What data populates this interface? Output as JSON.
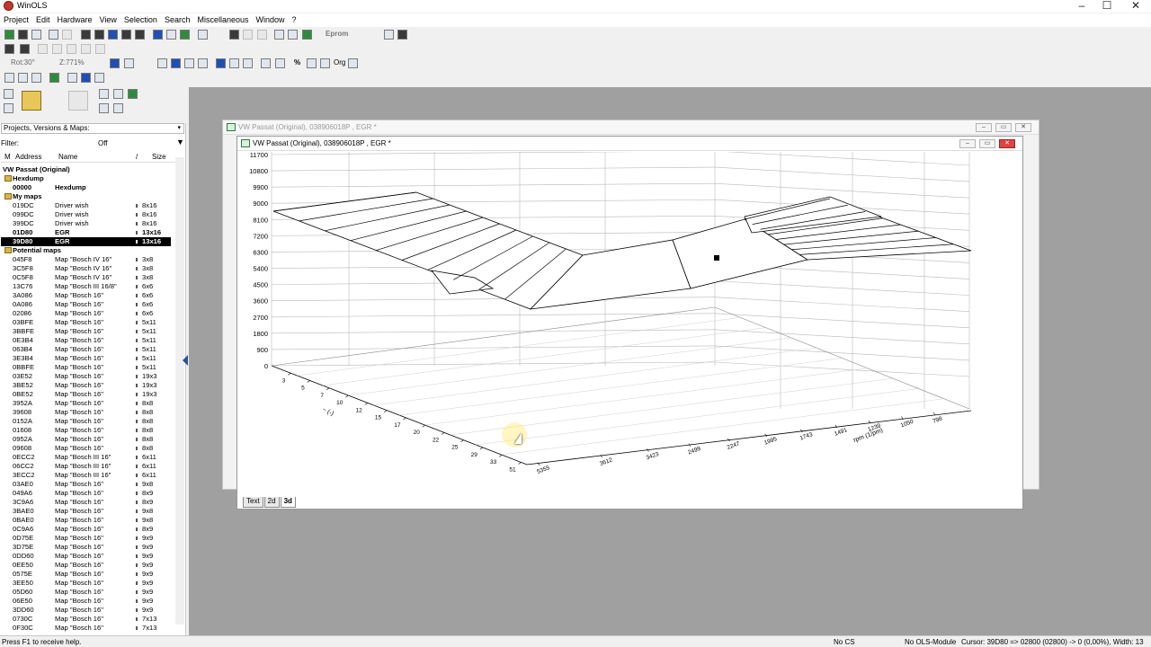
{
  "app": {
    "title": "WinOLS"
  },
  "menu": [
    "Project",
    "Edit",
    "Hardware",
    "View",
    "Selection",
    "Search",
    "Miscellaneous",
    "Window",
    "?"
  ],
  "toolbar": {
    "eprom_label": "Eprom",
    "rot_label": "Rot:30°",
    "zoom_label": "Z:771%",
    "pct_label": "%",
    "org_label": "Org"
  },
  "left_panel": {
    "dropdown_value": "Projects, Versions & Maps:",
    "filter_label": "Filter:",
    "filter_value": "Off",
    "headers": {
      "m": "M",
      "address": "Address",
      "name": "Name",
      "size": "Size"
    },
    "project": "VW Passat (Original)",
    "groups": {
      "hexdump": "Hexdump",
      "my_maps": "My maps",
      "potential": "Potential maps"
    },
    "hexdump_row": {
      "address": "00000",
      "name": "Hexdump"
    },
    "my_maps": [
      {
        "address": "019DC",
        "name": "Driver wish",
        "size": "8x16"
      },
      {
        "address": "099DC",
        "name": "Driver wish",
        "size": "8x16"
      },
      {
        "address": "399DC",
        "name": "Driver wish",
        "size": "8x16"
      },
      {
        "address": "01D80",
        "name": "EGR",
        "size": "13x16"
      },
      {
        "address": "39D80",
        "name": "EGR",
        "size": "13x16"
      }
    ],
    "potential_maps": [
      {
        "address": "045F8",
        "name": "Map \"Bosch IV 16\"",
        "size": "3x8"
      },
      {
        "address": "3C5F8",
        "name": "Map \"Bosch IV 16\"",
        "size": "3x8"
      },
      {
        "address": "0C5F8",
        "name": "Map \"Bosch IV 16\"",
        "size": "3x8"
      },
      {
        "address": "13C76",
        "name": "Map \"Bosch III 16/8\"",
        "size": "6x6"
      },
      {
        "address": "3A086",
        "name": "Map \"Bosch 16\"",
        "size": "6x6"
      },
      {
        "address": "0A086",
        "name": "Map \"Bosch 16\"",
        "size": "6x6"
      },
      {
        "address": "02086",
        "name": "Map \"Bosch 16\"",
        "size": "6x6"
      },
      {
        "address": "03BFE",
        "name": "Map \"Bosch 16\"",
        "size": "5x11"
      },
      {
        "address": "3BBFE",
        "name": "Map \"Bosch 16\"",
        "size": "5x11"
      },
      {
        "address": "0E3B4",
        "name": "Map \"Bosch 16\"",
        "size": "5x11"
      },
      {
        "address": "063B4",
        "name": "Map \"Bosch 16\"",
        "size": "5x11"
      },
      {
        "address": "3E3B4",
        "name": "Map \"Bosch 16\"",
        "size": "5x11"
      },
      {
        "address": "0BBFE",
        "name": "Map \"Bosch 16\"",
        "size": "5x11"
      },
      {
        "address": "03E52",
        "name": "Map \"Bosch 16\"",
        "size": "19x3"
      },
      {
        "address": "3BE52",
        "name": "Map \"Bosch 16\"",
        "size": "19x3"
      },
      {
        "address": "0BE52",
        "name": "Map \"Bosch 16\"",
        "size": "19x3"
      },
      {
        "address": "3952A",
        "name": "Map \"Bosch 16\"",
        "size": "8x8"
      },
      {
        "address": "39608",
        "name": "Map \"Bosch 16\"",
        "size": "8x8"
      },
      {
        "address": "0152A",
        "name": "Map \"Bosch 16\"",
        "size": "8x8"
      },
      {
        "address": "01608",
        "name": "Map \"Bosch 16\"",
        "size": "8x8"
      },
      {
        "address": "0952A",
        "name": "Map \"Bosch 16\"",
        "size": "8x8"
      },
      {
        "address": "09608",
        "name": "Map \"Bosch 16\"",
        "size": "8x8"
      },
      {
        "address": "0ECC2",
        "name": "Map \"Bosch III 16\"",
        "size": "6x11"
      },
      {
        "address": "06CC2",
        "name": "Map \"Bosch III 16\"",
        "size": "6x11"
      },
      {
        "address": "3ECC2",
        "name": "Map \"Bosch III 16\"",
        "size": "6x11"
      },
      {
        "address": "03AE0",
        "name": "Map \"Bosch 16\"",
        "size": "9x8"
      },
      {
        "address": "049A6",
        "name": "Map \"Bosch 16\"",
        "size": "8x9"
      },
      {
        "address": "3C9A6",
        "name": "Map \"Bosch 16\"",
        "size": "8x9"
      },
      {
        "address": "3BAE0",
        "name": "Map \"Bosch 16\"",
        "size": "9x8"
      },
      {
        "address": "0BAE0",
        "name": "Map \"Bosch 16\"",
        "size": "9x8"
      },
      {
        "address": "0C9A6",
        "name": "Map \"Bosch 16\"",
        "size": "8x9"
      },
      {
        "address": "0D75E",
        "name": "Map \"Bosch 16\"",
        "size": "9x9"
      },
      {
        "address": "3D75E",
        "name": "Map \"Bosch 16\"",
        "size": "9x9"
      },
      {
        "address": "0DD60",
        "name": "Map \"Bosch 16\"",
        "size": "9x9"
      },
      {
        "address": "0EE50",
        "name": "Map \"Bosch 16\"",
        "size": "9x9"
      },
      {
        "address": "0575E",
        "name": "Map \"Bosch 16\"",
        "size": "9x9"
      },
      {
        "address": "3EE50",
        "name": "Map \"Bosch 16\"",
        "size": "9x9"
      },
      {
        "address": "05D60",
        "name": "Map \"Bosch 16\"",
        "size": "9x9"
      },
      {
        "address": "06E50",
        "name": "Map \"Bosch 16\"",
        "size": "9x9"
      },
      {
        "address": "3DD60",
        "name": "Map \"Bosch 16\"",
        "size": "9x9"
      },
      {
        "address": "0730C",
        "name": "Map \"Bosch 16\"",
        "size": "7x13"
      },
      {
        "address": "0F30C",
        "name": "Map \"Bosch 16\"",
        "size": "7x13"
      }
    ]
  },
  "windows": {
    "back_title": "VW Passat (Original), 038906018P , EGR *",
    "front_title": "VW Passat (Original), 038906018P , EGR *",
    "tabs": [
      "Text",
      "2d",
      "3d"
    ]
  },
  "plot3d": {
    "z_ticks": [
      "11700",
      "10800",
      "9900",
      "9000",
      "8100",
      "7200",
      "6300",
      "5400",
      "4500",
      "3600",
      "2700",
      "1800",
      "900",
      "0"
    ],
    "x_ticks": [
      "3",
      "5",
      "7",
      "10",
      "12",
      "15",
      "17",
      "20",
      "22",
      "25",
      "29",
      "33",
      "51"
    ],
    "x_axis_label": "~ (-)",
    "y_ticks": [
      "5355",
      "3612",
      "3423",
      "2499",
      "2247",
      "1995",
      "1743",
      "1491",
      "1239",
      "1050",
      "798"
    ],
    "y_axis_label": "rpm (1/pm)",
    "surface_color": "#ffffff",
    "line_color": "#000000"
  },
  "statusbar": {
    "help": "Press F1 to receive help.",
    "cs": "No CS",
    "module": "No OLS-Module",
    "cursor": "Cursor: 39D80 => 02800 (02800) -> 0 (0,00%), Width: 13"
  }
}
